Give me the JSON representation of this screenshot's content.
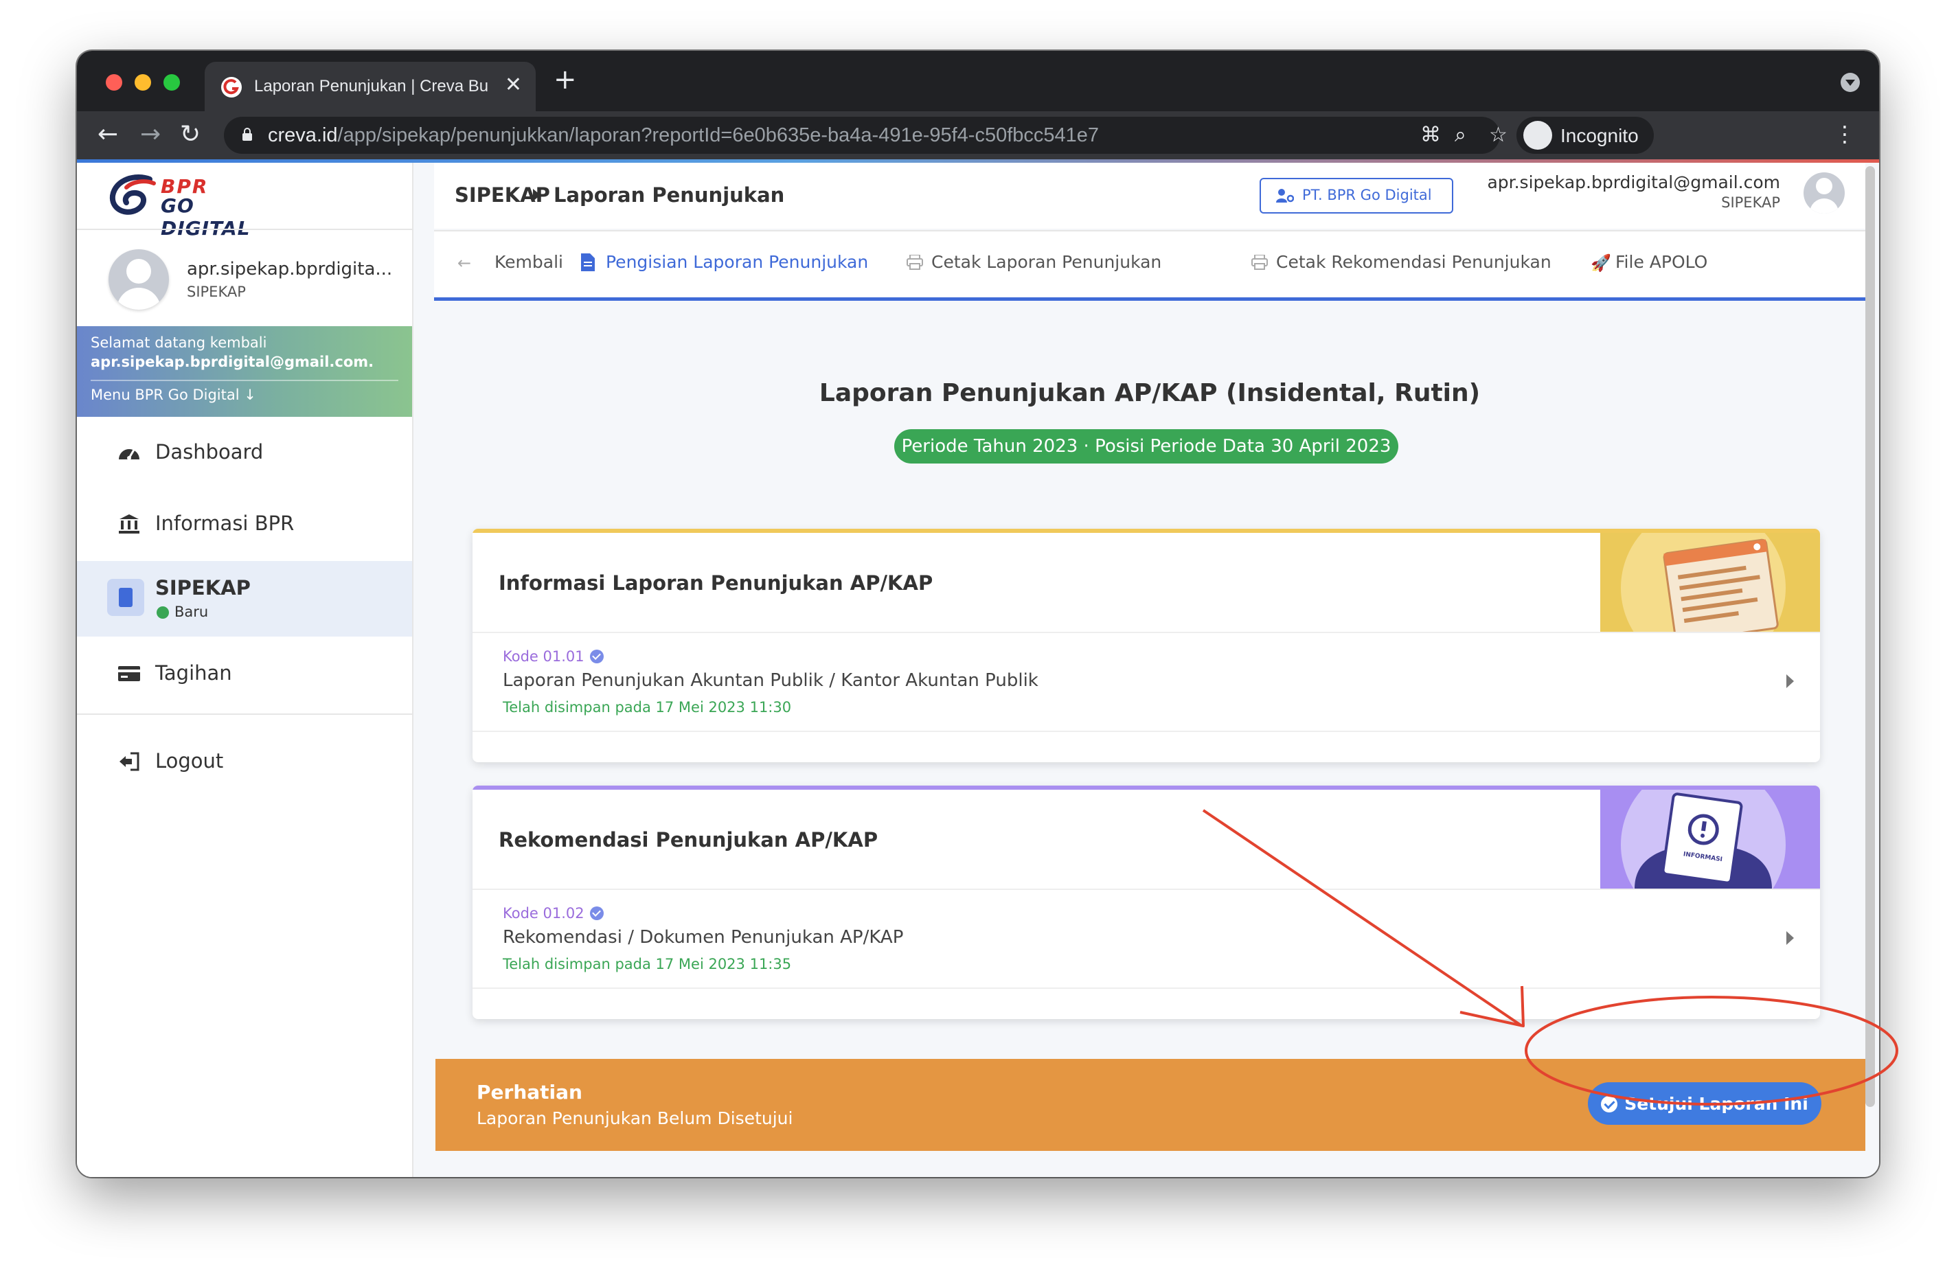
{
  "browser": {
    "tab_title": "Laporan Penunjukan | Creva Bu",
    "url_host": "creva.id",
    "url_path": "/app/sipekap/penunjukkan/laporan?reportId=6e0b635e-ba4a-491e-95f4-c50fbcc541e7",
    "profile_label": "Incognito"
  },
  "sidebar": {
    "logo_line1": "BPR",
    "logo_line2": "GO DIGITAL",
    "user_name": "apr.sipekap.bprdigita...",
    "user_role": "SIPEKAP",
    "welcome_line1": "Selamat datang kembali",
    "welcome_email": "apr.sipekap.bprdigital@gmail.com.",
    "welcome_menu": "Menu BPR Go Digital",
    "items": [
      {
        "label": "Dashboard",
        "icon": "speedometer-icon"
      },
      {
        "label": "Informasi BPR",
        "icon": "bank-icon"
      },
      {
        "label": "SIPEKAP",
        "badge": "Baru",
        "icon": "clipboard-check-icon",
        "active": true
      },
      {
        "label": "Tagihan",
        "icon": "credit-card-icon"
      }
    ],
    "logout_label": "Logout"
  },
  "header": {
    "crumb_root": "SIPEKAP",
    "crumb_page": "Laporan Penunjukan",
    "org_button": "PT. BPR Go Digital",
    "email": "apr.sipekap.bprdigital@gmail.com",
    "role": "SIPEKAP"
  },
  "tabs": {
    "back": "Kembali",
    "fill": "Pengisian Laporan Penunjukan",
    "print_report": "Cetak Laporan Penunjukan",
    "print_recommendation": "Cetak Rekomendasi Penunjukan",
    "file_apolo": "File APOLO"
  },
  "main": {
    "title": "Laporan Penunjukan AP/KAP (Insidental, Rutin)",
    "period": "Periode Tahun 2023 · Posisi Periode Data 30 April 2023"
  },
  "cards": [
    {
      "title": "Informasi Laporan Penunjukan AP/KAP",
      "code": "Kode 01.01",
      "item_title": "Laporan Penunjukan Akuntan Publik / Kantor Akuntan Publik",
      "saved": "Telah disimpan pada 17 Mei 2023 11:30",
      "accent": "#f0c95a"
    },
    {
      "title": "Rekomendasi Penunjukan AP/KAP",
      "code": "Kode 01.02",
      "item_title": "Rekomendasi / Dokumen Penunjukan AP/KAP",
      "saved": "Telah disimpan pada 17 Mei 2023 11:35",
      "accent": "#a98ff0",
      "illustration_text": "INFORMASI"
    }
  ],
  "alert": {
    "title": "Perhatian",
    "message": "Laporan Penunjukan Belum Disetujui",
    "button": "Setujui Laporan Ini",
    "color": "#e49642"
  }
}
